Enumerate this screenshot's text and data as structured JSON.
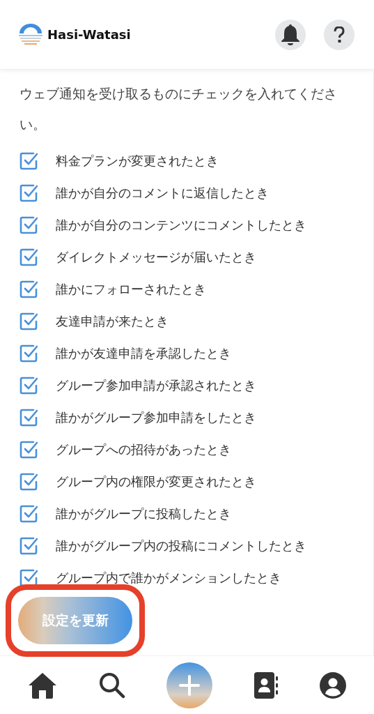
{
  "header": {
    "logo_text": "Hasi-Watasi"
  },
  "intro": "ウェブ通知を受け取るものにチェックを入れてください。",
  "options": [
    {
      "label": "料金プランが変更されたとき",
      "checked": true
    },
    {
      "label": "誰かが自分のコメントに返信したとき",
      "checked": true
    },
    {
      "label": "誰かが自分のコンテンツにコメントしたとき",
      "checked": true
    },
    {
      "label": "ダイレクトメッセージが届いたとき",
      "checked": true
    },
    {
      "label": "誰かにフォローされたとき",
      "checked": true
    },
    {
      "label": "友達申請が来たとき",
      "checked": true
    },
    {
      "label": "誰かが友達申請を承認したとき",
      "checked": true
    },
    {
      "label": "グループ参加申請が承認されたとき",
      "checked": true
    },
    {
      "label": "誰かがグループ参加申請をしたとき",
      "checked": true
    },
    {
      "label": "グループへの招待があったとき",
      "checked": true
    },
    {
      "label": "グループ内の権限が変更されたとき",
      "checked": true
    },
    {
      "label": "誰かがグループに投稿したとき",
      "checked": true
    },
    {
      "label": "誰かがグループ内の投稿にコメントしたとき",
      "checked": true
    },
    {
      "label": "グループ内で誰かがメンションしたとき",
      "checked": true
    }
  ],
  "submit_button": {
    "label": "設定を更新",
    "highlighted": true
  },
  "bottom_nav": [
    {
      "kind": "home"
    },
    {
      "kind": "search"
    },
    {
      "kind": "add"
    },
    {
      "kind": "contacts"
    },
    {
      "kind": "profile"
    }
  ]
}
